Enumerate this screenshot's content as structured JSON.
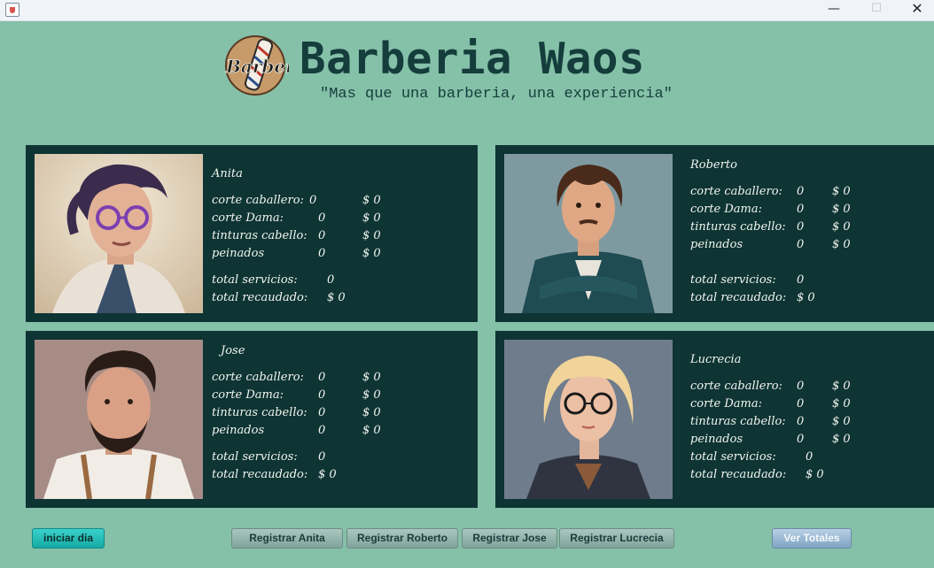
{
  "window": {
    "controls": {
      "minimize": "—",
      "maximize": "☐",
      "close": "✕"
    }
  },
  "header": {
    "title": "Barberia Waos",
    "subtitle": "\"Mas que una barberia, una experiencia\"",
    "logo_text": "Barber"
  },
  "barbers": [
    {
      "name": "Anita",
      "corte_caballero": "corte caballero:",
      "corte_caballero_qty": "0",
      "corte_caballero_amt": "$ 0",
      "corte_dama": "corte Dama:",
      "corte_dama_qty": "0",
      "corte_dama_amt": "$ 0",
      "tinturas": "tinturas cabello:",
      "tinturas_qty": "0",
      "tinturas_amt": "$ 0",
      "peinados": "peinados",
      "peinados_qty": "0",
      "peinados_amt": "$ 0",
      "total_servicios": "total servicios:",
      "total_servicios_val": "0",
      "total_recaudado": "total recaudado:",
      "total_recaudado_val": "$ 0"
    },
    {
      "name": "Roberto",
      "corte_caballero": "corte caballero:",
      "corte_caballero_qty": "0",
      "corte_caballero_amt": "$ 0",
      "corte_dama": "corte Dama:",
      "corte_dama_qty": "0",
      "corte_dama_amt": "$ 0",
      "tinturas": "tinturas cabello:",
      "tinturas_qty": "0",
      "tinturas_amt": "$ 0",
      "peinados": "peinados",
      "peinados_qty": "0",
      "peinados_amt": "$ 0",
      "total_servicios": "total servicios:",
      "total_servicios_val": "0",
      "total_recaudado": "total recaudado:",
      "total_recaudado_val": "$ 0"
    },
    {
      "name": "Jose",
      "corte_caballero": "corte caballero:",
      "corte_caballero_qty": "0",
      "corte_caballero_amt": "$ 0",
      "corte_dama": "corte Dama:",
      "corte_dama_qty": "0",
      "corte_dama_amt": "$ 0",
      "tinturas": "tinturas cabello:",
      "tinturas_qty": "0",
      "tinturas_amt": "$ 0",
      "peinados": "peinados",
      "peinados_qty": "0",
      "peinados_amt": "$ 0",
      "total_servicios": "total servicios:",
      "total_servicios_val": "0",
      "total_recaudado": "total recaudado:",
      "total_recaudado_val": "$ 0"
    },
    {
      "name": "Lucrecia",
      "corte_caballero": "corte caballero:",
      "corte_caballero_qty": "0",
      "corte_caballero_amt": "$ 0",
      "corte_dama": "corte Dama:",
      "corte_dama_qty": "0",
      "corte_dama_amt": "$ 0",
      "tinturas": "tinturas cabello:",
      "tinturas_qty": "0",
      "tinturas_amt": "$ 0",
      "peinados": "peinados",
      "peinados_qty": "0",
      "peinados_amt": "$ 0",
      "total_servicios": "total servicios:",
      "total_servicios_val": "0",
      "total_recaudado": "total recaudado:",
      "total_recaudado_val": "$ 0"
    }
  ],
  "buttons": {
    "start_day": "iniciar dia",
    "register_anita": "Registrar Anita",
    "register_roberto": "Registrar Roberto",
    "register_jose": "Registrar Jose",
    "register_lucrecia": "Registrar Lucrecia",
    "view_totals": "Ver Totales"
  },
  "colors": {
    "background": "#85c0a8",
    "card": "#0e3434",
    "title": "#143d3c",
    "start_button": "#16aaa3"
  }
}
